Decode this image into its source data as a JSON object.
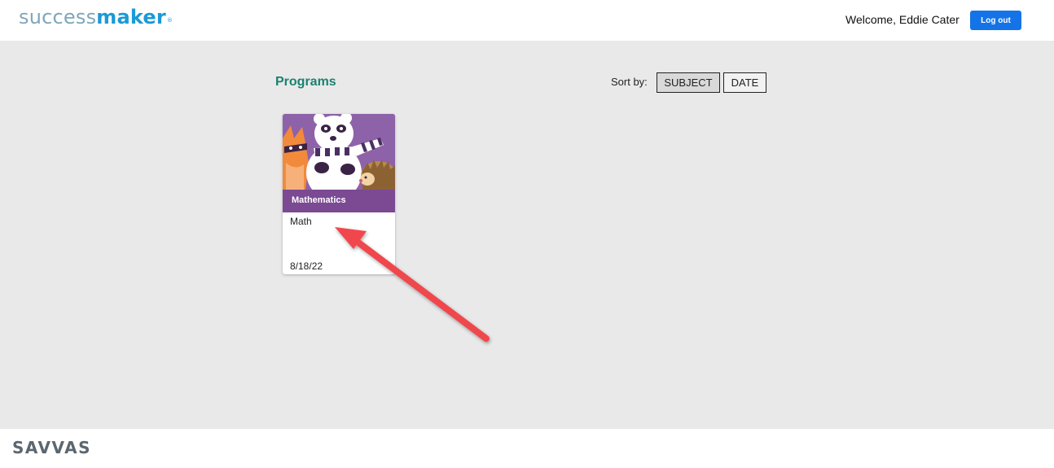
{
  "header": {
    "logo_part1": "success",
    "logo_part2": "maker",
    "logo_mark": "®",
    "welcome_text": "Welcome, Eddie Cater",
    "logout_label": "Log out"
  },
  "main": {
    "programs_title": "Programs",
    "sort_label": "Sort by:",
    "sort_options": [
      "SUBJECT",
      "DATE"
    ],
    "selected_sort": "SUBJECT"
  },
  "program_cards": [
    {
      "subject": "Mathematics",
      "name": "Math",
      "date": "8/18/22",
      "artwork": "math-characters-illustration"
    }
  ],
  "annotation": {
    "icon": "red-arrow-pointer",
    "color": "#f0464e"
  },
  "footer": {
    "brand": "SAVVAS"
  },
  "colors": {
    "accent_blue": "#1473e6",
    "programs_green": "#1a8271",
    "card_purple": "#7b4a93",
    "background_gray": "#e9e9e9"
  }
}
